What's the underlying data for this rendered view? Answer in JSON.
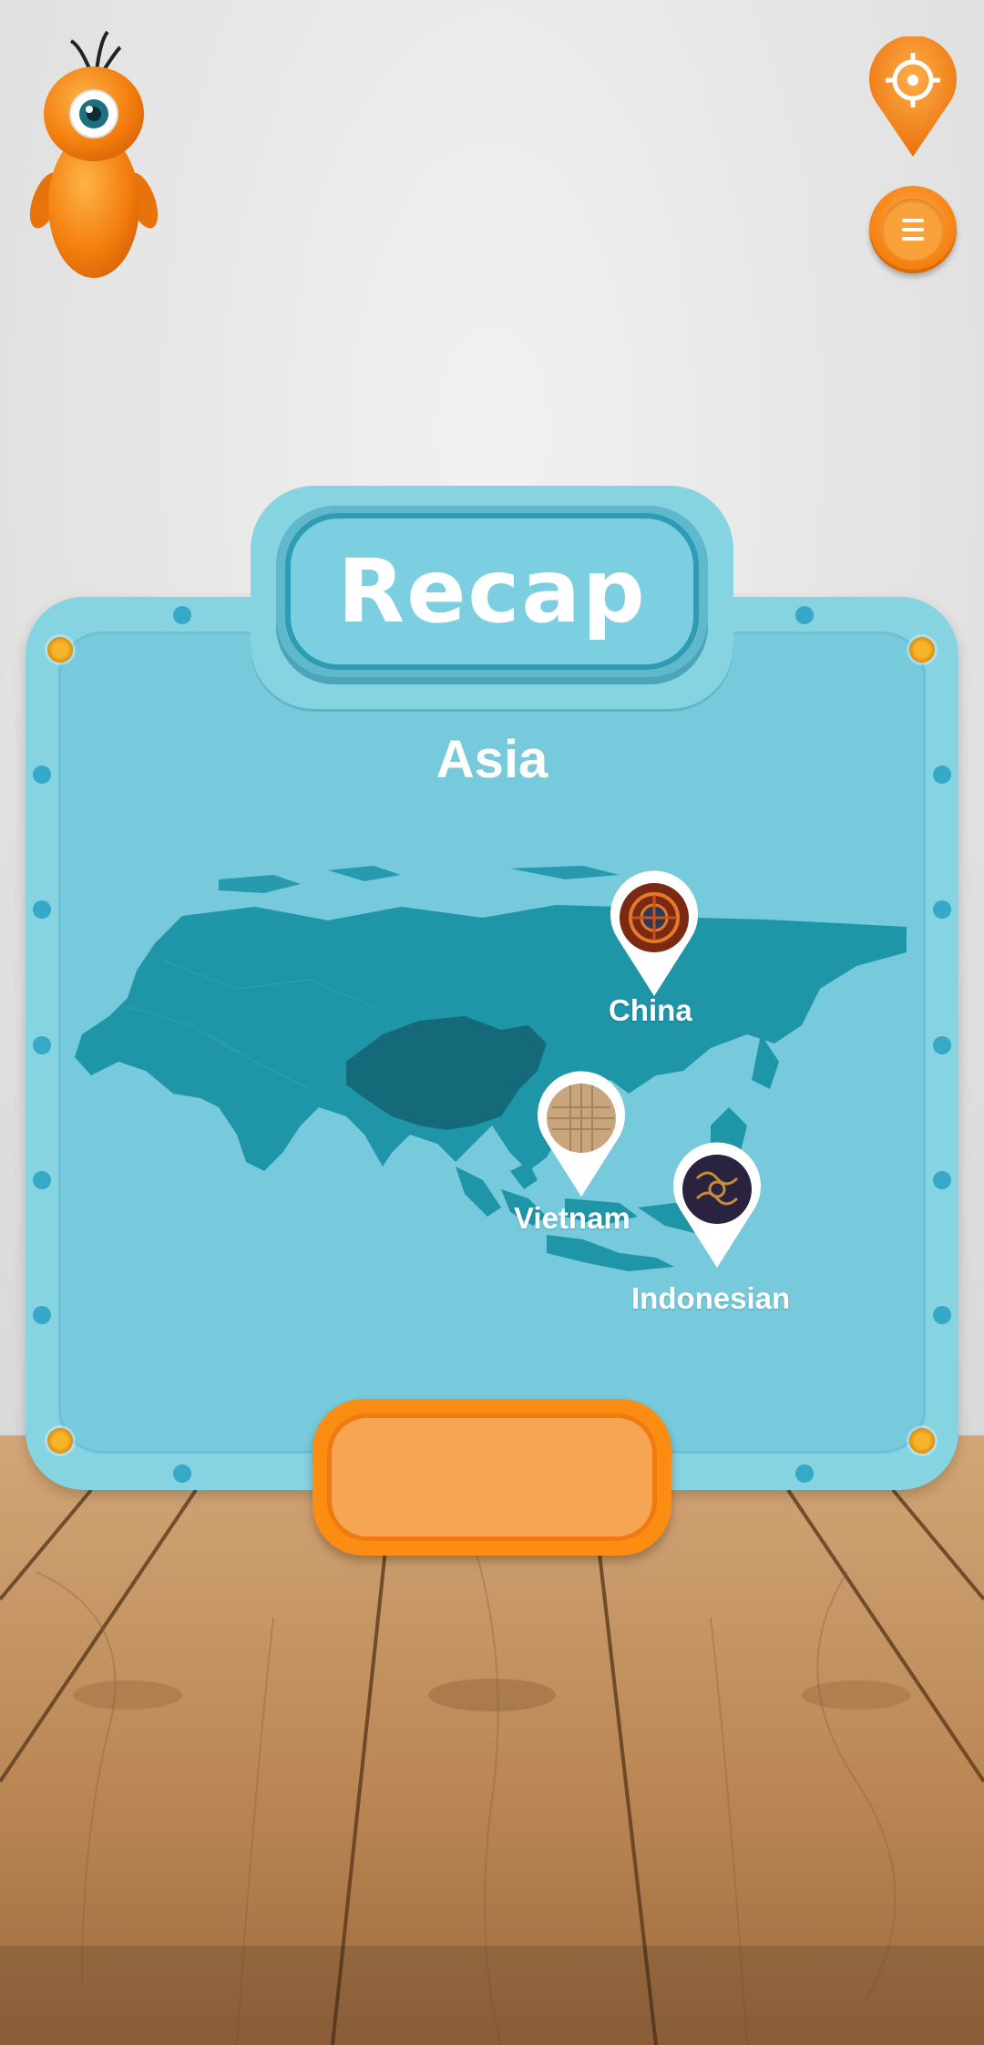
{
  "header": {
    "mascot_icon": "orange-one-eyed-mascot",
    "locate_icon": "crosshair-location-pin-icon",
    "menu_icon": "hamburger-menu-icon"
  },
  "card": {
    "title": "Recap",
    "region": "Asia"
  },
  "pins": [
    {
      "label": "China",
      "pattern": "red-ornament-pattern"
    },
    {
      "label": "Vietnam",
      "pattern": "woven-bamboo-pattern"
    },
    {
      "label": "Indonesian",
      "pattern": "batik-pattern"
    }
  ],
  "action_button": {
    "label": ""
  },
  "colors": {
    "accent_orange": "#fb8e12",
    "card_blue": "#76cadc",
    "map_dark": "#1f95a8",
    "map_highlight": "#146a78"
  }
}
